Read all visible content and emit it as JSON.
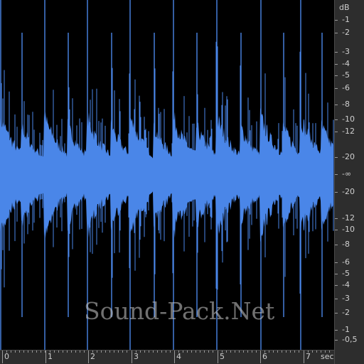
{
  "window": {
    "background": "#000000",
    "wave_color": "#4a86e8",
    "ruler_bg": "#2d2d2d"
  },
  "db_scale": {
    "unit": "dB",
    "labels": [
      "-1",
      "-2",
      "-3",
      "-4",
      "-5",
      "-6",
      "-8",
      "-10",
      "-12",
      "-20",
      "-∞",
      "-20",
      "-12",
      "-10",
      "-8",
      "-6",
      "-5",
      "-4",
      "-3",
      "-2",
      "-1",
      "-0,5"
    ]
  },
  "time_scale": {
    "unit": "sec",
    "labels": [
      "0",
      "1",
      "2",
      "3",
      "4",
      "5",
      "6",
      "7"
    ]
  },
  "watermark": "Sound-Pack.Net",
  "icons": []
}
